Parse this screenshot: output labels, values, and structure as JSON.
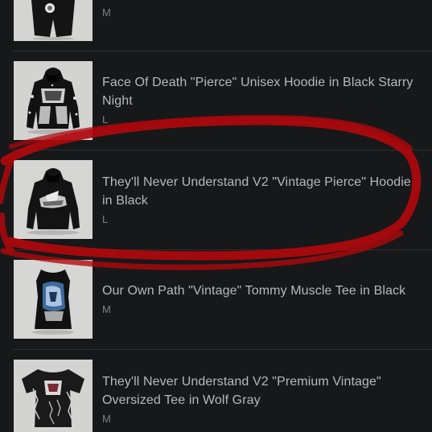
{
  "order_items": [
    {
      "title": "",
      "size": "M",
      "image_icon": "shorts-product-image-icon"
    },
    {
      "title": "Face Of Death \"Pierce\" Unisex Hoodie in Black Starry Night",
      "size": "L",
      "image_icon": "hoodie-product-image-icon"
    },
    {
      "title": "They'll Never Understand V2 \"Vintage Pierce\" Hoodie in Black",
      "size": "L",
      "image_icon": "hoodie-product-image-icon"
    },
    {
      "title": "Our Own Path \"Vintage\" Tommy Muscle Tee in Black",
      "size": "M",
      "image_icon": "muscle-tee-product-image-icon"
    },
    {
      "title": "They'll Never Understand V2 \"Premium Vintage\" Oversized Tee in Wolf Gray",
      "size": "M",
      "image_icon": "oversized-tee-product-image-icon"
    }
  ],
  "colors": {
    "background": "#171819",
    "title_text": "#b7b9bb",
    "size_text": "#7c7f82",
    "annotation_red": "#b1080c"
  }
}
